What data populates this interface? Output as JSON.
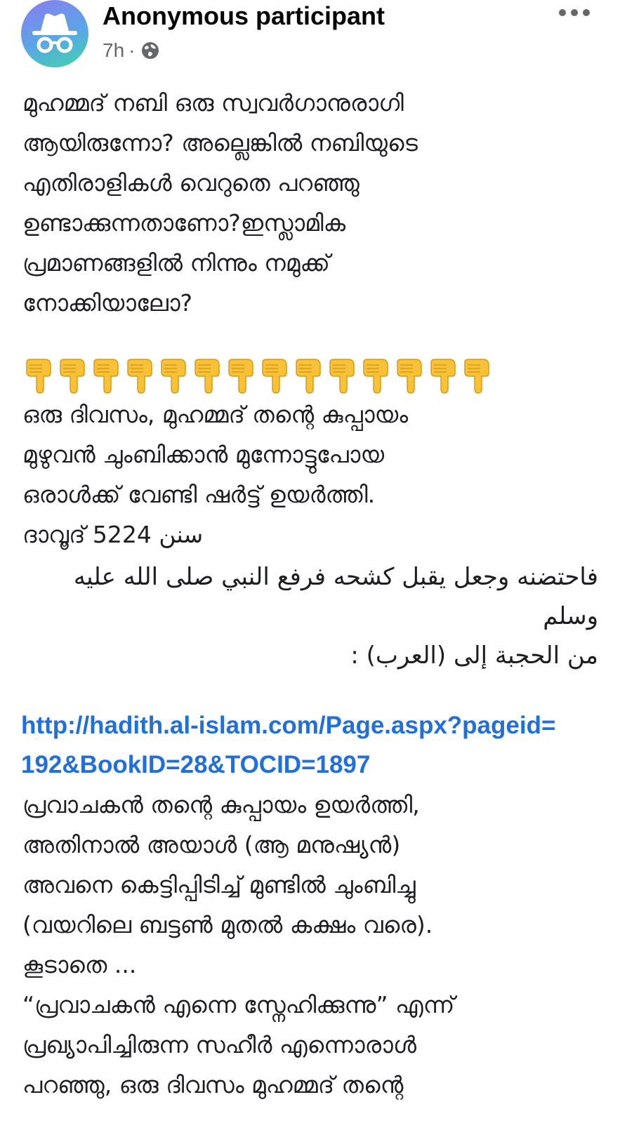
{
  "post": {
    "author": "Anonymous participant",
    "time": "7h",
    "meta_separator": "·",
    "icons": {
      "avatar": "incognito-icon",
      "audience": "globe-icon",
      "more": "more-options-icon",
      "emoji": "backhand-index-pointing-down"
    },
    "colors": {
      "link": "#216fdb",
      "secondary": "#65676b",
      "emoji": "#f7c236"
    },
    "emoji_count": 14,
    "intro_lines": [
      "മുഹമ്മദ് നബി ഒരു സ്വവർഗാനുരാഗി",
      "ആയിരുന്നോ? അല്ലെങ്കിൽ നബിയുടെ",
      "എതിരാളികൾ വെറുതെ പറഞ്ഞു",
      "ഉണ്ടാക്കുന്നതാണോ?ഇസ്ലാമിക",
      "പ്രമാണങ്ങളിൽ നിന്നും നമുക്ക്",
      "നോക്കിയാലോ?"
    ],
    "story_lines": [
      " ഒരു ദിവസം, മുഹമ്മദ് തന്റെ കുപ്പായം",
      "മുഴുവൻ ചുംബിക്കാൻ മുന്നോട്ടുപോയ",
      "ഒരാൾക്ക് വേണ്ടി ഷർട്ട് ഉയർത്തി."
    ],
    "reference": " ദാവൂദ് 5224 سنن",
    "arabic_lines": [
      "فاحتضنه وجعل يقبل كشحه فرفع النبي صلى الله عليه",
      "وسلم",
      "من الحجبة إلى (العرب) :"
    ],
    "link_lines": [
      "http://hadith.al-islam.com/Page.aspx?pageid=",
      "192&BookID=28&TOCID=1897"
    ],
    "translation_lines": [
      " പ്രവാചകൻ തന്റെ കുപ്പായം ഉയർത്തി,",
      "അതിനാൽ അയാൾ (ആ മനുഷ്യൻ)",
      "അവനെ കെട്ടിപ്പിടിച്ച് മുണ്ടിൽ ചുംബിച്ചു",
      "(വയറിലെ ബട്ടൺ മുതൽ കക്ഷം വരെ).",
      " കൂടാതെ ...",
      " “പ്രവാചകൻ എന്നെ സ്നേഹിക്കുന്നു” എന്ന്",
      "പ്രഖ്യാപിച്ചിരുന്ന സഹീർ എന്നൊരാൾ",
      "പറഞ്ഞു, ഒരു ദിവസം മുഹമ്മദ് തന്റെ"
    ]
  }
}
